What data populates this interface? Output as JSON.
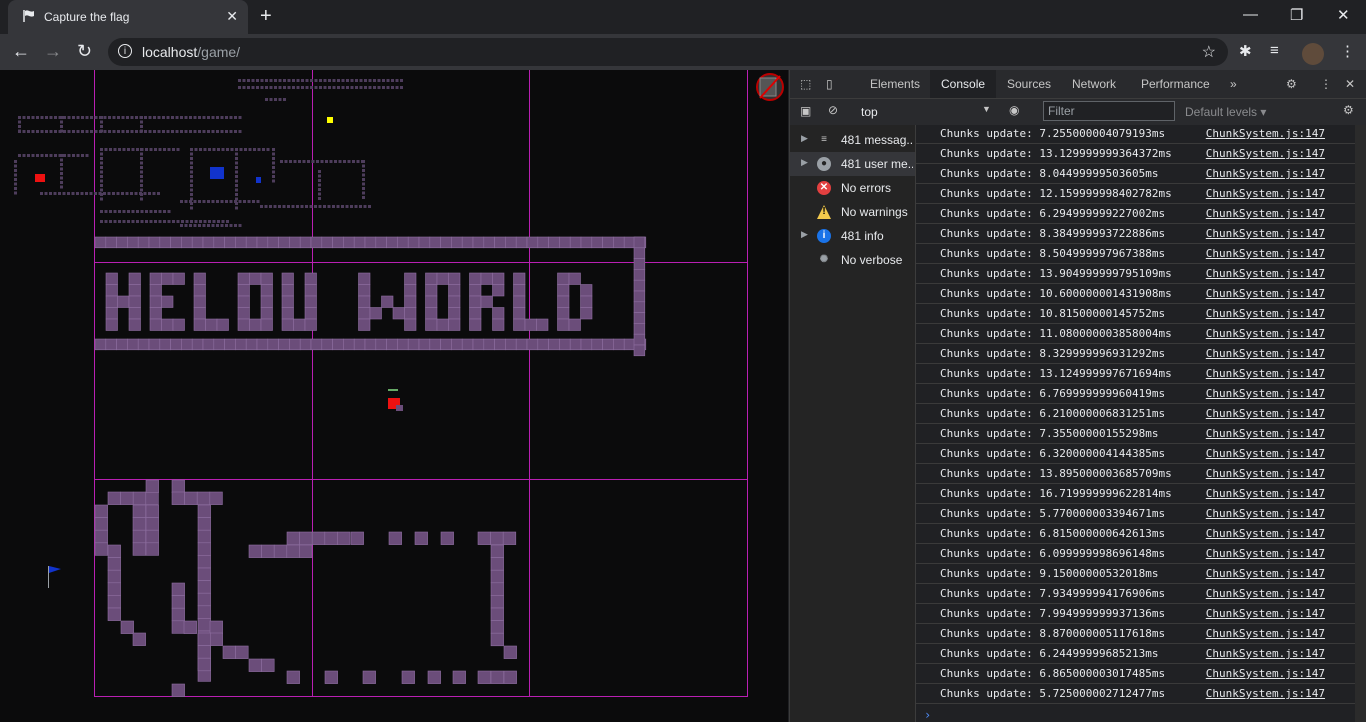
{
  "browser": {
    "tab_title": "Capture the flag",
    "tab_close": "✕",
    "new_tab": "+",
    "url_host": "localhost",
    "url_path": "/game/",
    "window_controls": [
      "—",
      "❐",
      "✕"
    ]
  },
  "game": {
    "banner_text": "HELOU WORLD",
    "colors": {
      "grid": "#b91fb3",
      "block": "#6b4d7a",
      "block_edge": "#8e6fa0",
      "red": "#e11",
      "blue": "#13c",
      "yellow": "#ff0"
    }
  },
  "devtools": {
    "tabs": [
      "Elements",
      "Console",
      "Sources",
      "Network",
      "Performance"
    ],
    "active_tab": "Console",
    "more": "»",
    "context": "top",
    "filter_placeholder": "Filter",
    "levels": "Default levels ▾",
    "sidebar": [
      {
        "label": "481 messag...",
        "icon": "list-icon",
        "arrow": true
      },
      {
        "label": "481 user me...",
        "icon": "user-icon",
        "arrow": true
      },
      {
        "label": "No errors",
        "icon": "error-icon",
        "arrow": false
      },
      {
        "label": "No warnings",
        "icon": "warning-icon",
        "arrow": false
      },
      {
        "label": "481 info",
        "icon": "info-icon",
        "arrow": true
      },
      {
        "label": "No verbose",
        "icon": "bug-icon",
        "arrow": false
      }
    ],
    "source": "ChunkSystem.js:147",
    "messages": [
      "Chunks update: 7.255000004079193ms",
      "Chunks update: 13.129999999364372ms",
      "Chunks update: 8.04499999503605ms",
      "Chunks update: 12.159999998402782ms",
      "Chunks update: 6.294999999227002ms",
      "Chunks update: 8.384999993722886ms",
      "Chunks update: 8.504999997967388ms",
      "Chunks update: 13.904999999795109ms",
      "Chunks update: 10.600000001431908ms",
      "Chunks update: 10.81500000145752ms",
      "Chunks update: 11.080000003858004ms",
      "Chunks update: 8.329999996931292ms",
      "Chunks update: 13.124999997671694ms",
      "Chunks update: 6.769999999960419ms",
      "Chunks update: 6.210000006831251ms",
      "Chunks update: 7.35500000155298ms",
      "Chunks update: 6.320000004144385ms",
      "Chunks update: 13.895000003685709ms",
      "Chunks update: 16.719999999622814ms",
      "Chunks update: 5.770000003394671ms",
      "Chunks update: 6.815000000642613ms",
      "Chunks update: 6.099999998696148ms",
      "Chunks update: 9.15000000532018ms",
      "Chunks update: 7.934999994176906ms",
      "Chunks update: 7.994999999937136ms",
      "Chunks update: 8.870000005117618ms",
      "Chunks update: 6.24499999685213ms",
      "Chunks update: 6.865000003017485ms",
      "Chunks update: 5.725000002712477ms"
    ],
    "prompt": "›"
  }
}
